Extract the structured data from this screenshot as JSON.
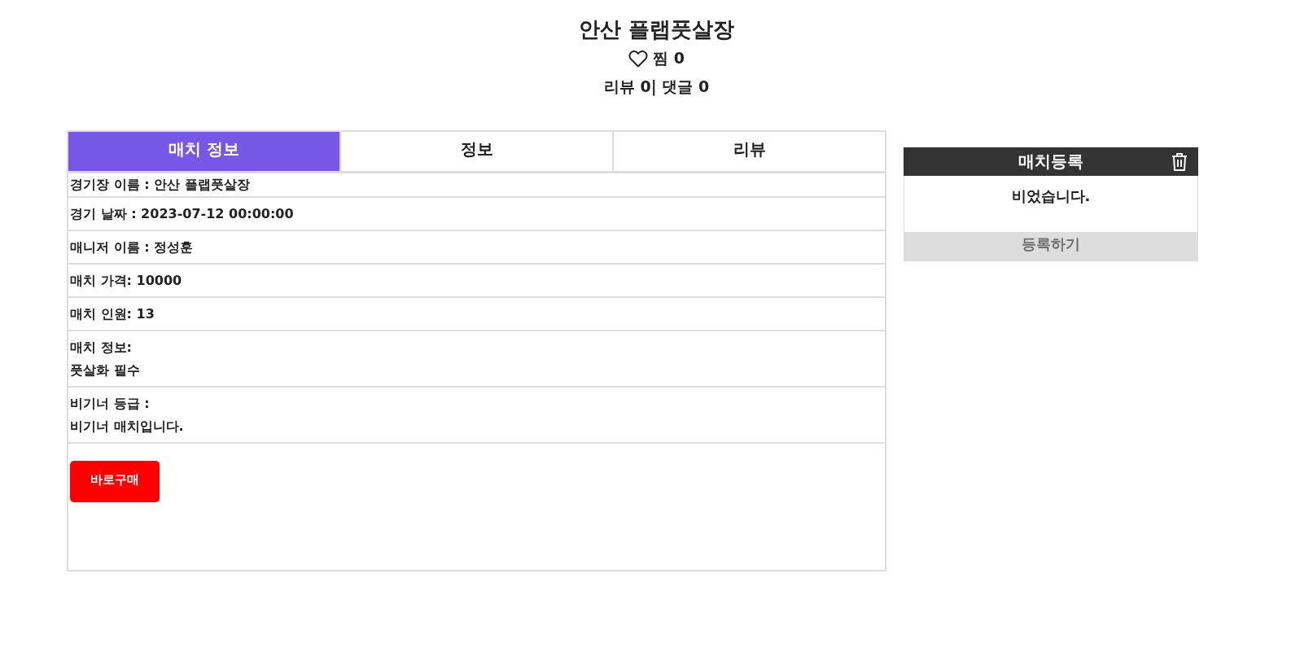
{
  "header": {
    "title": "안산 플랩풋살장",
    "likes": {
      "label": "찜 0",
      "liked": false
    },
    "stats": "리뷰 0| 댓글 0"
  },
  "tabs": [
    {
      "label": "매치 정보",
      "selected": true
    },
    {
      "label": "정보",
      "selected": false
    },
    {
      "label": "리뷰",
      "selected": false
    }
  ],
  "details": [
    {
      "lines": [
        "경기장 이름 : 안산 플랩풋살장"
      ]
    },
    {
      "lines": [
        "경기 날짜 : 2023-07-12 00:00:00"
      ]
    },
    {
      "lines": [
        "매니저 이름 : 정성훈"
      ]
    },
    {
      "lines": [
        "매치 가격: 10000"
      ]
    },
    {
      "lines": [
        "매치 인원: 13"
      ]
    },
    {
      "lines": [
        "매치 정보:",
        "풋살화 필수"
      ]
    },
    {
      "lines": [
        "비기너 등급 :",
        "비기너 매치입니다."
      ]
    }
  ],
  "buy_button": "바로구매",
  "cart": {
    "title": "매치등록",
    "empty_message": "비었습니다.",
    "register_button": {
      "label": "등록하기",
      "disabled": true
    }
  }
}
